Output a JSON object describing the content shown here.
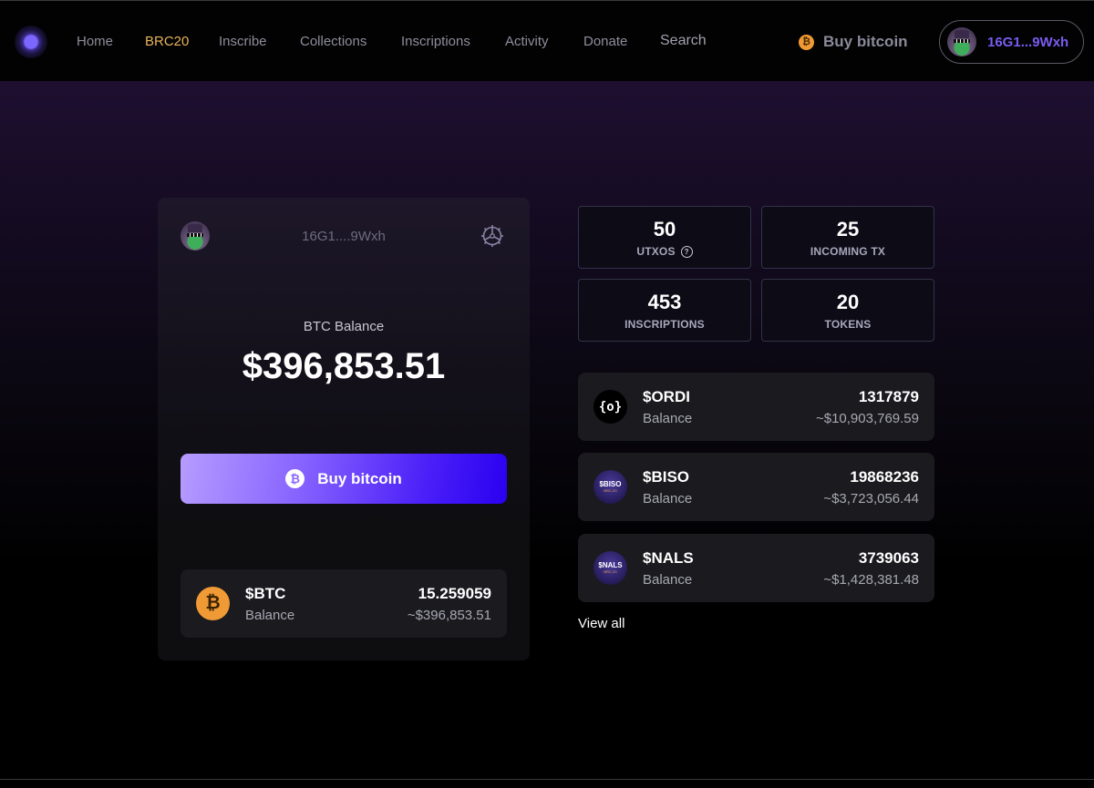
{
  "nav": {
    "items": [
      {
        "label": "Home",
        "active": false
      },
      {
        "label": "BRC20",
        "active": true
      },
      {
        "label": "Inscribe",
        "active": false
      },
      {
        "label": "Collections",
        "active": false
      },
      {
        "label": "Inscriptions",
        "active": false
      },
      {
        "label": "Activity",
        "active": false
      },
      {
        "label": "Donate",
        "active": false
      },
      {
        "label": "Search",
        "active": false
      }
    ],
    "buy_label": "Buy bitcoin",
    "wallet_address": "16G1...9Wxh",
    "colors": {
      "active": "#e8b45a",
      "wallet_address": "#7a5cf0"
    }
  },
  "wallet_card": {
    "address": "16G1....9Wxh",
    "balance_label": "BTC Balance",
    "balance_value": "$396,853.51",
    "buy_button_label": "Buy bitcoin",
    "btc_row": {
      "name": "$BTC",
      "sub": "Balance",
      "amount": "15.259059",
      "usd": "~$396,853.51"
    }
  },
  "stats": [
    {
      "value": "50",
      "label": "UTXOS",
      "has_help": true
    },
    {
      "value": "25",
      "label": "INCOMING TX",
      "has_help": false
    },
    {
      "value": "453",
      "label": "INSCRIPTIONS",
      "has_help": false
    },
    {
      "value": "20",
      "label": "TOKENS",
      "has_help": false
    }
  ],
  "tokens": [
    {
      "name": "$ORDI",
      "sub": "Balance",
      "amount": "1317879",
      "usd": "~$10,903,769.59",
      "icon_text": "{o}"
    },
    {
      "name": "$BISO",
      "sub": "Balance",
      "amount": "19868236",
      "usd": "~$3,723,056.44",
      "icon_text": "$BISO",
      "icon_sub": "BRC-20"
    },
    {
      "name": "$NALS",
      "sub": "Balance",
      "amount": "3739063",
      "usd": "~$1,428,381.48",
      "icon_text": "$NALS",
      "icon_sub": "BRC-20"
    }
  ],
  "view_all_label": "View all",
  "icons": {
    "btc": "₿",
    "help": "?"
  }
}
